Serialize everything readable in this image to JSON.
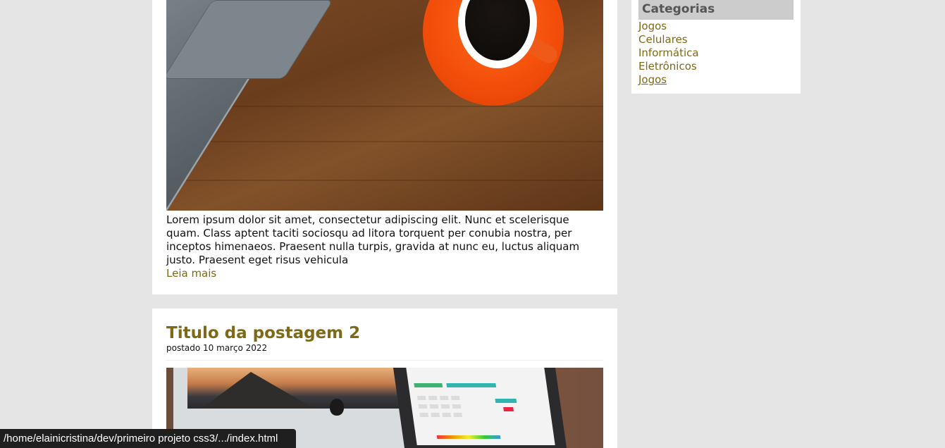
{
  "posts": [
    {
      "excerpt": "Lorem ipsum dolor sit amet, consectetur adipiscing elit. Nunc et scelerisque quam. Class aptent taciti sociosqu ad litora torquent per conubia nostra, per inceptos himenaeos. Praesent nulla turpis, gravida at nunc eu, luctus aliquam justo. Praesent eget risus vehicula",
      "read_more": "Leia mais"
    },
    {
      "title": "Titulo da postagem 2",
      "date": "postado 10 março 2022"
    }
  ],
  "sidebar": {
    "title": "Categorias",
    "items": [
      {
        "label": "Jogos"
      },
      {
        "label": "Celulares"
      },
      {
        "label": "Informática"
      },
      {
        "label": "Eletrônicos"
      },
      {
        "label": "Jogos"
      }
    ]
  },
  "statusbar": {
    "url": "/home/elainicristina/dev/primeiro projeto css3/.../index.html"
  },
  "colors": {
    "page_background": "#e5e5e5",
    "panel_background": "#ffffff",
    "link_accent": "#7d6a17",
    "sidebar_header_bg": "#cccccc",
    "sidebar_header_text": "#555555"
  }
}
